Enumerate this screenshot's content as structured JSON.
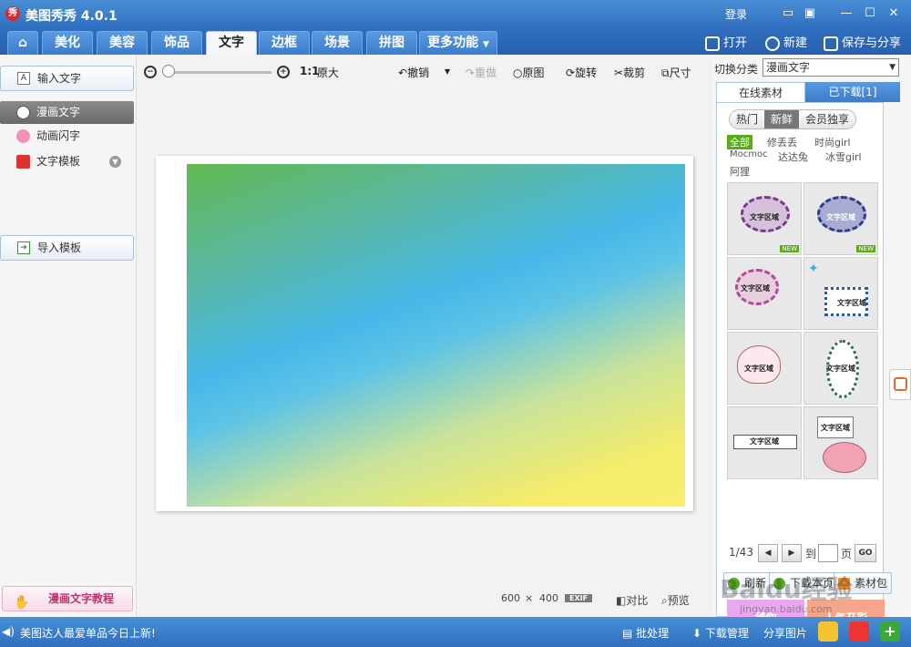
{
  "titlebar": {
    "logo_text": "秀",
    "title": "美图秀秀 4.0.1",
    "login": "登录"
  },
  "tabs": [
    "美化",
    "美容",
    "饰品",
    "文字",
    "边框",
    "场景",
    "拼图",
    "更多功能"
  ],
  "active_tab": "文字",
  "top_actions": {
    "open": "打开",
    "new": "新建",
    "save_share": "保存与分享"
  },
  "left": {
    "input_text": "输入文字",
    "menu": [
      "漫画文字",
      "动画闪字",
      "文字模板"
    ],
    "import_template": "导入模板",
    "tutorial": "漫画文字教程"
  },
  "canvas_toolbar": {
    "ratio": "1:1",
    "original_size": "原大",
    "undo": "撤销",
    "redo": "重做",
    "original_image": "原图",
    "rotate": "旋转",
    "crop": "裁剪",
    "size": "尺寸"
  },
  "canvas": {
    "width": "600",
    "times": "×",
    "height": "400",
    "exif": "EXIF",
    "compare": "对比",
    "preview": "预览"
  },
  "right": {
    "switch_category": "切换分类",
    "category": "漫画文字",
    "tab_online": "在线素材",
    "tab_downloaded": "已下载[1]",
    "filters": [
      "热门",
      "新鲜",
      "会员独享"
    ],
    "selected_filter": "新鲜",
    "authors": [
      "全部",
      "修丢丢",
      "时尚girl",
      "Mocmoc",
      "达达兔",
      "冰雪girl",
      "阿狸"
    ],
    "thumb_label": "文字区域",
    "new_badge": "NEW",
    "pager": {
      "page": "1/43",
      "to": "到",
      "page_unit": "页",
      "go": "GO"
    },
    "refresh": "刷新",
    "download_page": "下载本页",
    "material_pack": "素材包",
    "ads": [
      "猜你",
      "人气开彩"
    ]
  },
  "statusbar": {
    "news": "美图达人最爱单品今日上新!",
    "batch": "批处理",
    "download_manager": "下载管理",
    "share_image": "分享图片"
  },
  "watermark": {
    "text": "Baidu经验",
    "url": "jingyan.baidu.com"
  },
  "colors": {
    "title_blue": "#2f6fbf",
    "accent_green": "#5aaa1a",
    "active_menu": "#777777"
  }
}
